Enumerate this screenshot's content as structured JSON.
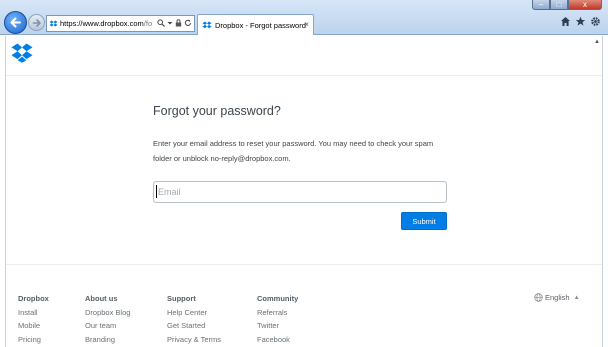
{
  "browser": {
    "address": {
      "host": "https://www.dropbox.com",
      "rest": "/fo"
    },
    "tab": {
      "title": "Dropbox - Forgot password",
      "close": "×"
    },
    "window_controls": {
      "minimize": "–",
      "maximize": "□",
      "close": "x"
    },
    "icons": [
      "back-arrow-icon",
      "forward-arrow-icon",
      "dropbox-favicon",
      "search-icon",
      "dropdown-icon",
      "lock-icon",
      "refresh-icon",
      "home-icon",
      "star-icon",
      "gear-icon"
    ]
  },
  "main": {
    "title": "Forgot your password?",
    "instructions": "Enter your email address to reset your password. You may need to check your spam folder or unblock no-reply@dropbox.com.",
    "email": {
      "value": "",
      "placeholder": "Email"
    },
    "submit_label": "Submit"
  },
  "footer": {
    "columns": [
      {
        "heading": "Dropbox",
        "links": [
          "Install",
          "Mobile",
          "Pricing"
        ]
      },
      {
        "heading": "About us",
        "links": [
          "Dropbox Blog",
          "Our team",
          "Branding"
        ]
      },
      {
        "heading": "Support",
        "links": [
          "Help Center",
          "Get Started",
          "Privacy & Terms"
        ]
      },
      {
        "heading": "Community",
        "links": [
          "Referrals",
          "Twitter",
          "Facebook"
        ]
      }
    ],
    "language": "English"
  },
  "colors": {
    "accent": "#007ee5",
    "text": "#3d464d",
    "chrome": "#bcd3ee"
  }
}
